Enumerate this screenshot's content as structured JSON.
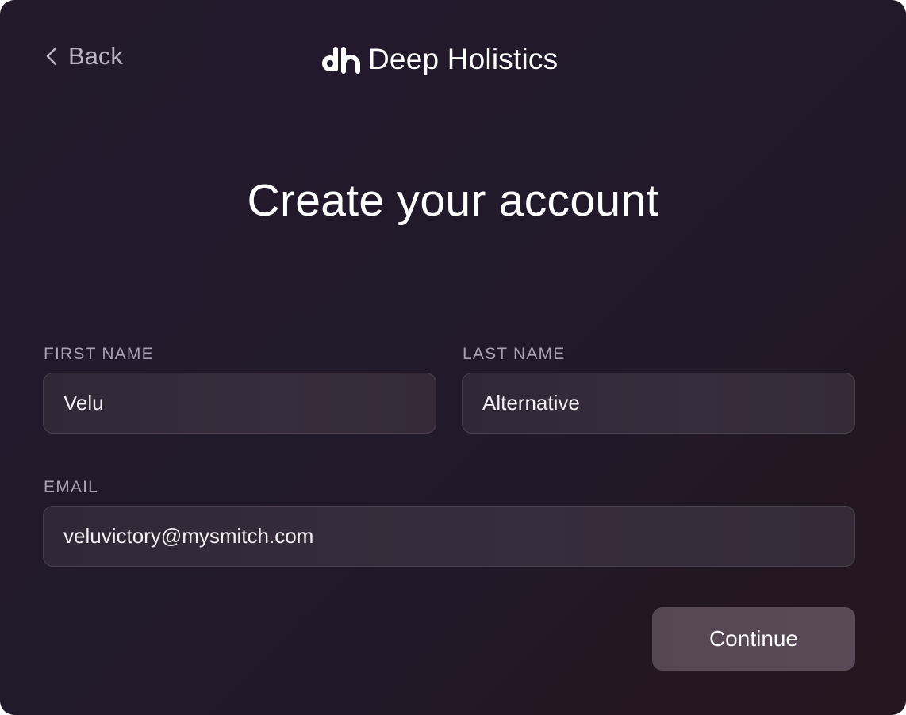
{
  "header": {
    "back_label": "Back",
    "brand_name": "Deep Holistics",
    "brand_logo_icon": "dh-logo-icon",
    "back_icon": "chevron-left-icon"
  },
  "main": {
    "title": "Create your account"
  },
  "form": {
    "first_name": {
      "label": "FIRST NAME",
      "value": "Velu"
    },
    "last_name": {
      "label": "LAST NAME",
      "value": "Alternative"
    },
    "email": {
      "label": "EMAIL",
      "value": "veluvictory@mysmitch.com"
    },
    "continue_label": "Continue"
  },
  "colors": {
    "background": "#221a2b",
    "input_background": "#332a39",
    "input_border": "#4a4250",
    "button_background": "#574954",
    "label_text": "#a9a2b4",
    "text": "#ffffff"
  }
}
